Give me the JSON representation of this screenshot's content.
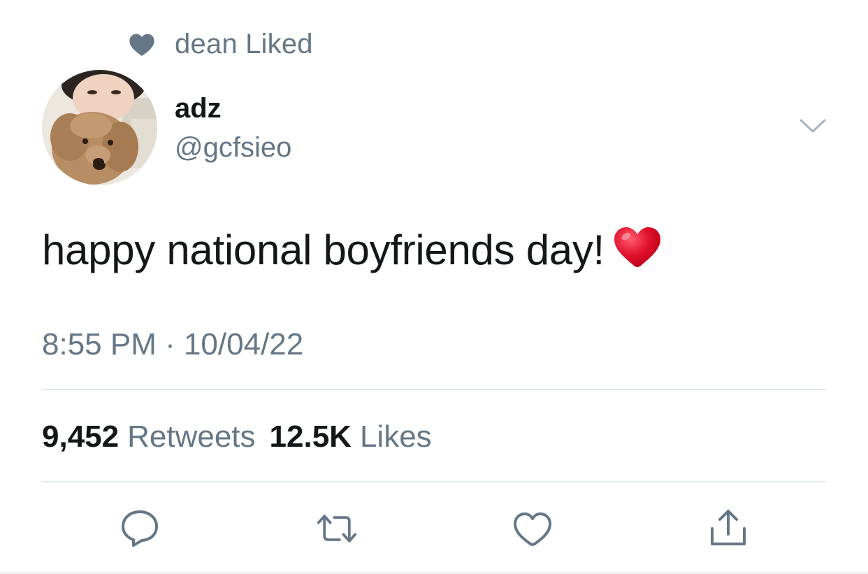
{
  "social_context": {
    "icon": "heart-icon",
    "text": "dean Liked"
  },
  "author": {
    "display_name": "adz",
    "handle": "@gcfsieo",
    "avatar": "avatar-photo-person-with-dog"
  },
  "tweet": {
    "text": "happy national boyfriends day!",
    "emoji": "red-heart-emoji",
    "timestamp": "8:55 PM · 10/04/22"
  },
  "stats": {
    "retweets_count": "9,452",
    "retweets_label": "Retweets",
    "likes_count": "12.5K",
    "likes_label": "Likes"
  },
  "actions": [
    {
      "name": "reply",
      "icon": "reply-icon"
    },
    {
      "name": "retweet",
      "icon": "retweet-icon"
    },
    {
      "name": "like",
      "icon": "heart-outline-icon"
    },
    {
      "name": "share",
      "icon": "share-icon"
    }
  ],
  "colors": {
    "primary_text": "#14171a",
    "secondary_text": "#657786",
    "divider": "#e1e8ed",
    "heart_emoji": "#e0102b"
  }
}
